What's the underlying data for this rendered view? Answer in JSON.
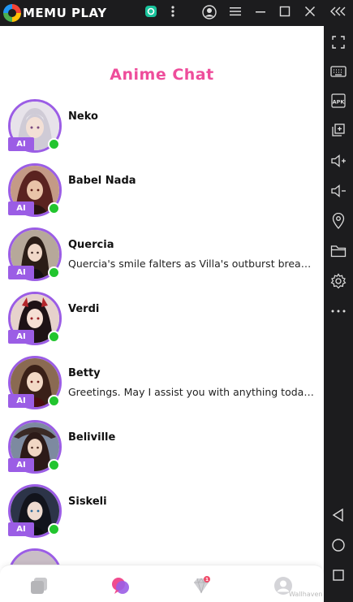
{
  "emulator": {
    "brand": "MEMU PLAY",
    "top_icons": [
      "memu-logo-icon",
      "assistant-icon",
      "more-vertical-icon",
      "account-icon",
      "menu-icon",
      "minimize-icon",
      "maximize-icon",
      "close-icon",
      "collapse-sidebar-icon"
    ],
    "side_icons": [
      "fullscreen-icon",
      "keyboard-icon",
      "apk-icon",
      "multi-window-icon",
      "volume-up-icon",
      "volume-down-icon",
      "location-icon",
      "folder-icon",
      "settings-icon",
      "more-icon",
      "back-icon",
      "home-icon",
      "recent-apps-icon"
    ],
    "apk_label": "APK"
  },
  "app": {
    "title": "Anime Chat",
    "badge_label": "AI",
    "accent_color": "#9b5de5",
    "title_color": "#ee4d9b",
    "online_color": "#22c52e"
  },
  "chats": [
    {
      "name": "Neko",
      "message": ""
    },
    {
      "name": "Babel Nada",
      "message": ""
    },
    {
      "name": "Quercia",
      "message": "Quercia's smile falters as Villa's outburst breaks the silence and she looks"
    },
    {
      "name": "Verdi",
      "message": ""
    },
    {
      "name": "Betty",
      "message": "Greetings. May I assist you with anything today?"
    },
    {
      "name": "Beliville",
      "message": ""
    },
    {
      "name": "Siskeli",
      "message": ""
    }
  ],
  "bottom_nav": {
    "items": [
      "cards-icon",
      "chat-icon",
      "diamond-icon",
      "profile-icon"
    ],
    "diamond_badge": "1"
  },
  "watermark": "Wallhaven"
}
